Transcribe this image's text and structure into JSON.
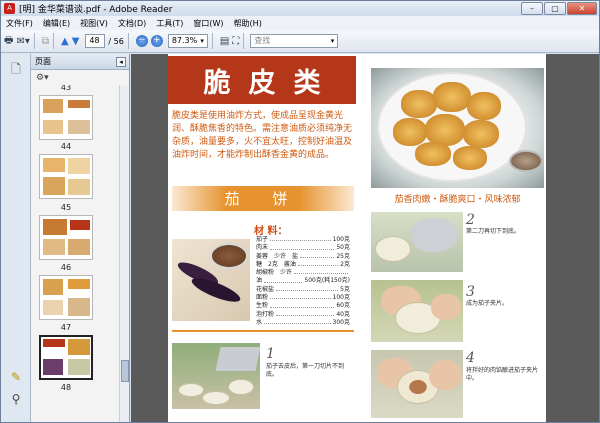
{
  "window": {
    "title": "[明] 金华菜谱谈.pdf - Adobe Reader",
    "controls": [
      "–",
      "▢",
      "✕"
    ]
  },
  "menu": [
    "文件(F)",
    "编辑(E)",
    "视图(V)",
    "文档(D)",
    "工具(T)",
    "窗口(W)",
    "帮助(H)"
  ],
  "toolbar": {
    "page_current": "48",
    "page_total": "/ 56",
    "zoom": "87.3%",
    "search_placeholder": "查找"
  },
  "thumbnail_panel": {
    "title": "页面",
    "pages": [
      {
        "num": "43",
        "selected": false
      },
      {
        "num": "44",
        "selected": false
      },
      {
        "num": "45",
        "selected": false
      },
      {
        "num": "46",
        "selected": false
      },
      {
        "num": "47",
        "selected": false
      },
      {
        "num": "48",
        "selected": true
      }
    ]
  },
  "page": {
    "category_chars": [
      "脆",
      "皮",
      "类"
    ],
    "intro": "脆皮类是使用油炸方式，使成品呈现金黄光润、酥脆焦香的特色。需注意油质必须纯净无杂质，油量要多，火不宜太旺，控制好油温及油炸时间，才能炸制出酥香金黄的成品。",
    "dish_name": "茄 饼",
    "ingredients_label": "材 料：",
    "ingredients": [
      {
        "name": "茄子",
        "amount": "100克"
      },
      {
        "name": "肉末",
        "amount": "50克"
      },
      {
        "name": "姜蓉　少许　盐",
        "amount": "25克"
      },
      {
        "name": "糖　2克　酱油",
        "amount": "2克"
      },
      {
        "name": "胡椒粉　少许",
        "amount": ""
      },
      {
        "name": "油",
        "amount": "500克(耗150克)"
      },
      {
        "name": "花椒盐",
        "amount": "5克"
      },
      {
        "name": "面粉",
        "amount": "100克"
      },
      {
        "name": "生粉",
        "amount": "60克"
      },
      {
        "name": "泡打粉",
        "amount": "40克"
      },
      {
        "name": "水",
        "amount": "300克"
      }
    ],
    "photo_caption": "茄香肉嫩・酥脆爽口・风味浓郁",
    "steps": [
      {
        "num": "1",
        "text": "茄子去皮后，第一刀切片不到底。"
      },
      {
        "num": "2",
        "text": "第二刀再切下到底。"
      },
      {
        "num": "3",
        "text": "成为茄子夹片。"
      },
      {
        "num": "4",
        "text": "将拌好的肉馅酿进茄子夹片中。"
      }
    ]
  }
}
